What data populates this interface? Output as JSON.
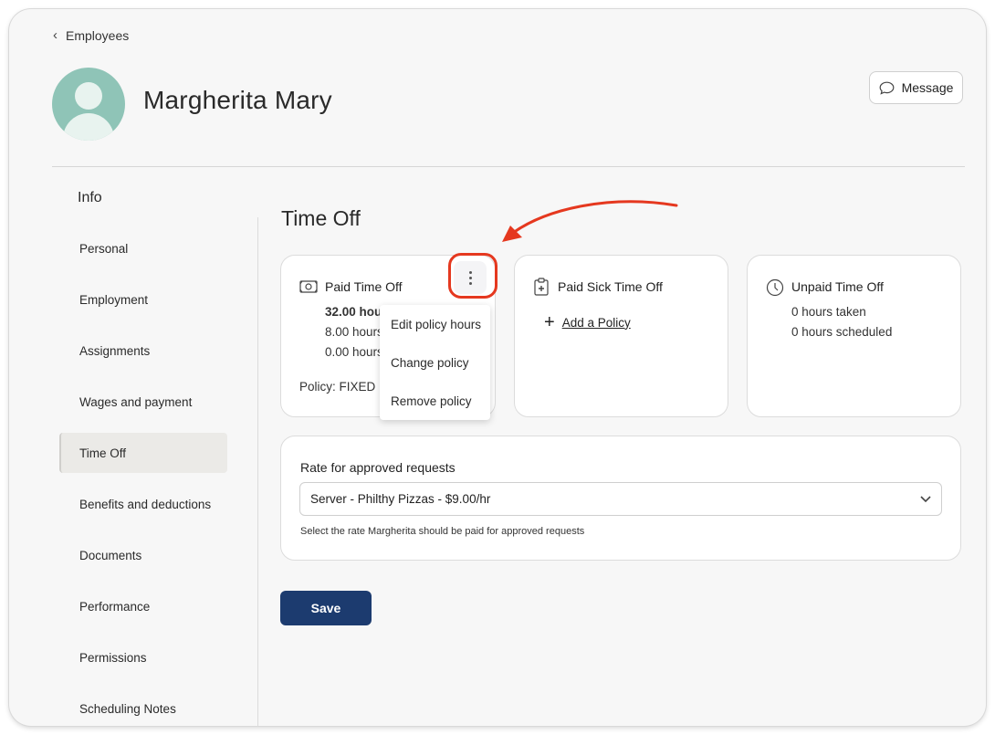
{
  "header": {
    "back_label": "Employees",
    "employee_name": "Margherita Mary",
    "message_label": "Message"
  },
  "sidebar": {
    "title": "Info",
    "items": [
      {
        "label": "Personal"
      },
      {
        "label": "Employment"
      },
      {
        "label": "Assignments"
      },
      {
        "label": "Wages and payment"
      },
      {
        "label": "Time Off",
        "active": true
      },
      {
        "label": "Benefits and deductions"
      },
      {
        "label": "Documents"
      },
      {
        "label": "Performance"
      },
      {
        "label": "Permissions"
      },
      {
        "label": "Scheduling Notes"
      }
    ]
  },
  "main": {
    "section_title": "Time Off",
    "cards": {
      "paid": {
        "title": "Paid Time Off",
        "line1": "32.00 hou",
        "line2": "8.00 hours",
        "line3": "0.00 hours",
        "policy": "Policy: FIXED P"
      },
      "sick": {
        "title": "Paid Sick Time Off",
        "add_policy": "Add a Policy"
      },
      "unpaid": {
        "title": "Unpaid Time Off",
        "taken": "0 hours taken",
        "scheduled": "0 hours scheduled"
      }
    },
    "policy_menu": {
      "items": [
        "Edit policy hours",
        "Change policy",
        "Remove policy"
      ]
    },
    "rate": {
      "label": "Rate for approved requests",
      "selected": "Server - Philthy Pizzas - $9.00/hr",
      "help": "Select the rate Margherita should be paid for approved requests"
    },
    "save_label": "Save"
  },
  "colors": {
    "accent": "#1c3b6f",
    "annotation": "#e5381f",
    "avatar": "#8fc4b7"
  }
}
